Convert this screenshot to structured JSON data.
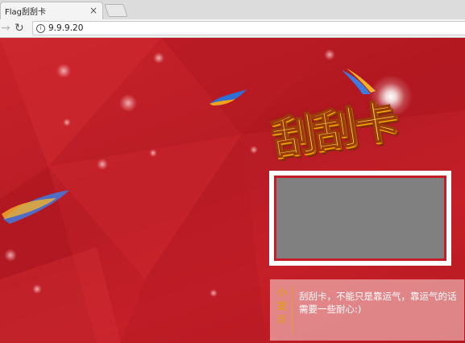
{
  "browser": {
    "tab_title": "Flag刮刮卡",
    "tab_close": "×",
    "url": "9.9.9.20",
    "forward_glyph": "→",
    "reload_glyph": "↻",
    "info_glyph": "i"
  },
  "page": {
    "title": "刮刮卡",
    "tip_label": "小提示",
    "tip_text": "刮刮卡，不能只是靠运气，靠运气的话需要一些耐心:)",
    "scratch_cover_color": "#808080",
    "background_color": "#c41f29"
  },
  "icons": [
    "info-icon",
    "forward-icon",
    "reload-icon",
    "close-icon",
    "new-tab-icon"
  ]
}
